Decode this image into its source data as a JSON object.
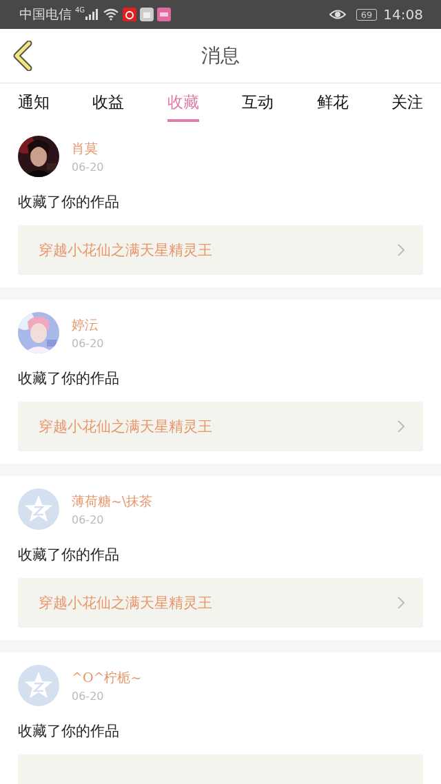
{
  "status_bar": {
    "carrier": "中国电信",
    "network": "4G",
    "battery": "69",
    "time": "14:08"
  },
  "header": {
    "title": "消息"
  },
  "tabs": [
    {
      "label": "通知",
      "selected": false
    },
    {
      "label": "收益",
      "selected": false
    },
    {
      "label": "收藏",
      "selected": true
    },
    {
      "label": "互动",
      "selected": false
    },
    {
      "label": "鲜花",
      "selected": false
    },
    {
      "label": "关注",
      "selected": false
    }
  ],
  "messages": [
    {
      "name": "肖莫",
      "date": "06-20",
      "text": "收藏了你的作品",
      "work": "穿越小花仙之满天星精灵王"
    },
    {
      "name": "婷沄",
      "date": "06-20",
      "text": "收藏了你的作品",
      "work": "穿越小花仙之满天星精灵王"
    },
    {
      "avatar": {
        "kind": "default"
      },
      "name": "薄荷糖~\\抹茶",
      "date": "06-20",
      "text": "收藏了你的作品",
      "work": "穿越小花仙之满天星精灵王"
    },
    {
      "avatar": {
        "kind": "default"
      },
      "name": "^O^柠栀~",
      "date": "06-20",
      "text": "收藏了你的作品"
    }
  ]
}
